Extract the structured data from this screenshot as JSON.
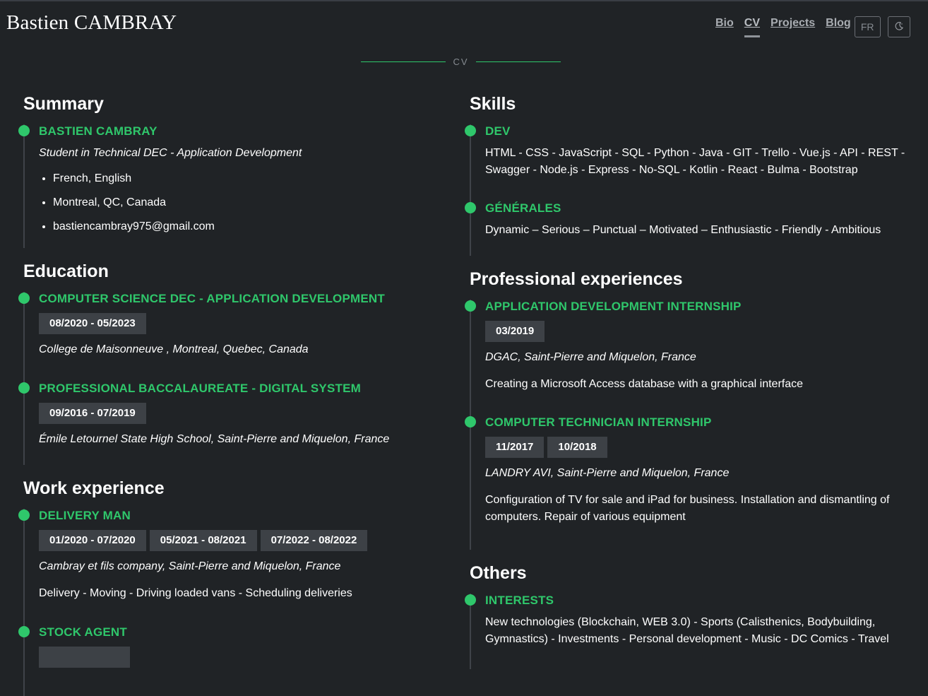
{
  "header": {
    "brand": "Bastien CAMBRAY",
    "nav": [
      "Bio",
      "CV",
      "Projects",
      "Blog"
    ],
    "active_nav": "CV",
    "lang_button": "FR",
    "theme_icon": "moon-icon"
  },
  "page_label": "CV",
  "colors": {
    "accent": "#2fc76b",
    "background": "#202326",
    "date_badge": "#3d4146"
  },
  "summary": {
    "title": "Summary",
    "name": "BASTIEN CAMBRAY",
    "subtitle": "Student in Technical DEC - Application Development",
    "items": [
      "French, English",
      "Montreal, QC, Canada",
      "bastiencambray975@gmail.com"
    ]
  },
  "education": {
    "title": "Education",
    "entries": [
      {
        "title": "COMPUTER SCIENCE DEC - APPLICATION DEVELOPMENT",
        "dates": [
          "08/2020 - 05/2023"
        ],
        "place": "College de Maisonneuve , Montreal, Quebec, Canada"
      },
      {
        "title": "PROFESSIONAL BACCALAUREATE - DIGITAL SYSTEM",
        "dates": [
          "09/2016 - 07/2019"
        ],
        "place": "Émile Letournel State High School, Saint-Pierre and Miquelon, France"
      }
    ]
  },
  "work": {
    "title": "Work experience",
    "entries": [
      {
        "title": "DELIVERY MAN",
        "dates": [
          "01/2020 - 07/2020",
          "05/2021 - 08/2021",
          "07/2022 - 08/2022"
        ],
        "place": "Cambray et fils company, Saint-Pierre and Miquelon, France",
        "desc": "Delivery - Moving - Driving loaded vans - Scheduling deliveries"
      },
      {
        "title": "STOCK AGENT"
      }
    ]
  },
  "skills": {
    "title": "Skills",
    "entries": [
      {
        "title": "DEV",
        "text": "HTML - CSS - JavaScript - SQL - Python - Java - GIT - Trello - Vue.js - API - REST - Swagger - Node.js - Express - No-SQL - Kotlin - React - Bulma - Bootstrap"
      },
      {
        "title": "GÉNÉRALES",
        "text": "Dynamic – Serious – Punctual – Motivated – Enthusiastic - Friendly - Ambitious"
      }
    ]
  },
  "professional": {
    "title": "Professional experiences",
    "entries": [
      {
        "title": "APPLICATION DEVELOPMENT INTERNSHIP",
        "dates": [
          "03/2019"
        ],
        "place": "DGAC, Saint-Pierre and Miquelon, France",
        "desc": "Creating a Microsoft Access database with a graphical interface"
      },
      {
        "title": "COMPUTER TECHNICIAN INTERNSHIP",
        "dates": [
          "11/2017",
          "10/2018"
        ],
        "place": "LANDRY AVI, Saint-Pierre and Miquelon, France",
        "desc": "Configuration of TV for sale and iPad for business. Installation and dismantling of computers. Repair of various equipment"
      }
    ]
  },
  "others": {
    "title": "Others",
    "entries": [
      {
        "title": "INTERESTS",
        "text": "New technologies (Blockchain, WEB 3.0) - Sports (Calisthenics, Bodybuilding, Gymnastics) - Investments - Personal development - Music - DC Comics - Travel"
      }
    ]
  }
}
